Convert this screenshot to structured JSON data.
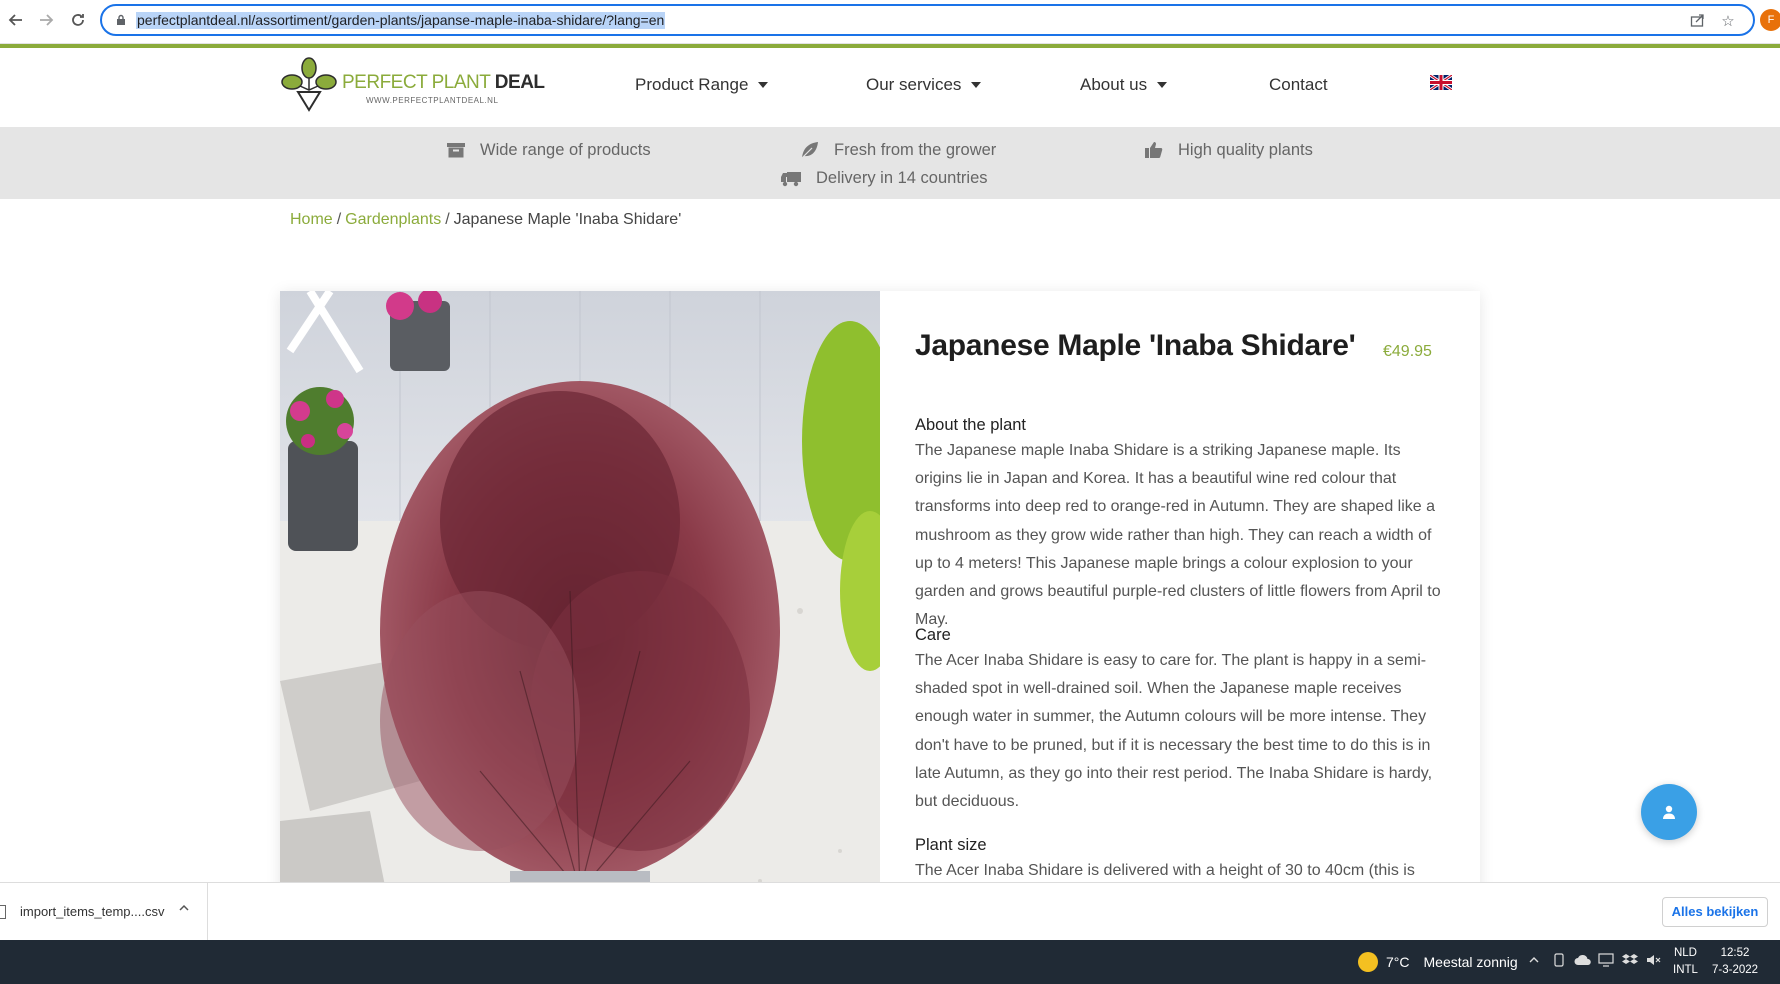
{
  "browser": {
    "url": "perfectplantdeal.nl/assortiment/garden-plants/japanse-maple-inaba-shidare/?lang=en",
    "profile_initial": "F"
  },
  "header": {
    "logo_main_light": "PERFECT PLANT ",
    "logo_main_bold": "DEAL",
    "logo_sub": "WWW.PERFECTPLANTDEAL.NL",
    "menu": [
      {
        "label": "Product Range"
      },
      {
        "label": "Our services"
      },
      {
        "label": "About us"
      },
      {
        "label": "Contact"
      }
    ],
    "language_flag": "uk-flag-icon"
  },
  "usp": [
    {
      "label": "Wide range of products",
      "icon": "box-icon"
    },
    {
      "label": "Fresh from the grower",
      "icon": "leaf-icon"
    },
    {
      "label": "High quality plants",
      "icon": "thumbs-up-icon"
    },
    {
      "label": "Delivery in 14 countries",
      "icon": "truck-icon"
    }
  ],
  "breadcrumb": {
    "home": "Home",
    "category": "Gardenplants",
    "current": "Japanese Maple 'Inaba Shidare'",
    "separator": "/"
  },
  "product": {
    "title": "Japanese Maple 'Inaba Shidare'",
    "price": "€49.95",
    "sections": [
      {
        "heading": "About the plant",
        "body": "The Japanese maple Inaba Shidare is a striking Japanese maple. Its origins lie in Japan and Korea. It has a beautiful wine red colour that transforms into deep red to orange-red in Autumn. They are shaped like a mushroom as they grow wide rather than high. They can reach a width of up to 4 meters! This Japanese maple brings a colour explosion to your garden and grows beautiful purple-red clusters of little flowers from April to May."
      },
      {
        "heading": "Care",
        "body": "The Acer Inaba Shidare is easy to care for. The plant is happy in a semi-shaded spot in well-drained soil. When the Japanese maple receives enough water in summer, the Autumn colours will be more intense. They don't have to be pruned, but if it is necessary the best time to do this is in late Autumn, as they go into their rest period. The Inaba Shidare is hardy, but deciduous."
      },
      {
        "heading": "Plant size",
        "body": "The Acer Inaba Shidare is delivered with a height of 30 to 40cm (this is"
      }
    ]
  },
  "download_bar": {
    "file_name": "import_items_temp....csv",
    "show_all": "Alles bekijken"
  },
  "taskbar": {
    "weather_temp": "7°C",
    "weather_desc": "Meestal zonnig",
    "lang_top": "NLD",
    "lang_bottom": "INTL",
    "time": "12:52",
    "date": "7-3-2022"
  },
  "colors": {
    "brand_green": "#8bab3b",
    "chat_blue": "#3aa0e6",
    "usp_bar": "#e5e5e5",
    "taskbar": "#202a35"
  }
}
